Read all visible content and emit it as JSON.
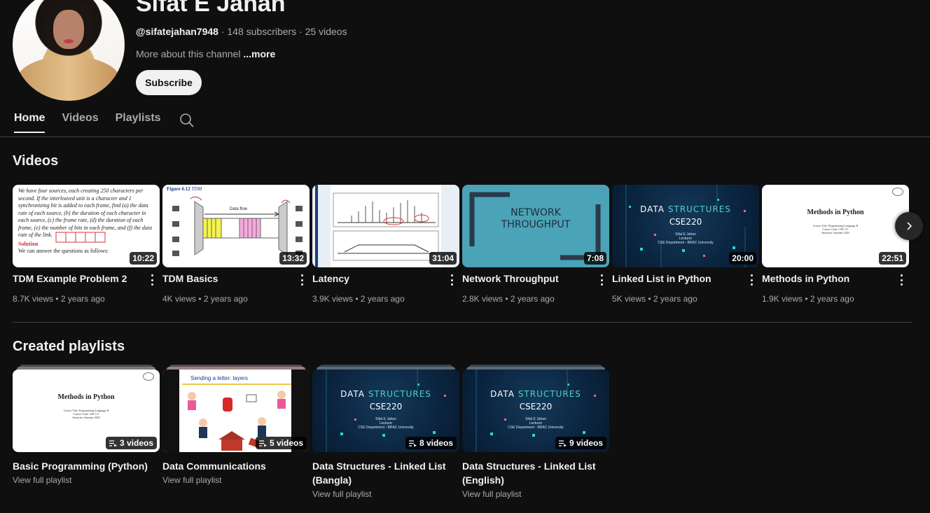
{
  "channel": {
    "name": "Sifat E Jahan",
    "handle": "@sifatejahan7948",
    "stats": " · 148 subscribers · 25 videos",
    "about": "More about this channel ",
    "about_more": "...more",
    "subscribe_label": "Subscribe"
  },
  "tabs": [
    {
      "label": "Home",
      "active": true
    },
    {
      "label": "Videos",
      "active": false
    },
    {
      "label": "Playlists",
      "active": false
    }
  ],
  "videos_section": {
    "title": "Videos",
    "items": [
      {
        "title": "TDM Example Problem 2",
        "duration": "10:22",
        "views": "8.7K views",
        "age": "2 years ago"
      },
      {
        "title": "TDM Basics",
        "duration": "13:32",
        "views": "4K views",
        "age": "2 years ago"
      },
      {
        "title": "Latency",
        "duration": "31:04",
        "views": "3.9K views",
        "age": "2 years ago"
      },
      {
        "title": "Network Throughput",
        "duration": "7:08",
        "views": "2.8K views",
        "age": "2 years ago"
      },
      {
        "title": "Linked List in Python",
        "duration": "20:00",
        "views": "5K views",
        "age": "2 years ago"
      },
      {
        "title": "Methods in Python",
        "duration": "22:51",
        "views": "1.9K views",
        "age": "2 years ago"
      }
    ]
  },
  "playlists_section": {
    "title": "Created playlists",
    "items": [
      {
        "title": "Basic Programming (Python)",
        "count": "3 videos",
        "link": "View full playlist"
      },
      {
        "title": "Data Communications",
        "count": "5 videos",
        "link": "View full playlist"
      },
      {
        "title": "Data Structures - Linked List (Bangla)",
        "count": "8 videos",
        "link": "View full playlist"
      },
      {
        "title": "Data Structures - Linked List (English)",
        "count": "9 videos",
        "link": "View full playlist"
      }
    ]
  },
  "thumb_text": {
    "tdm_problem": "We have four sources, each creating 250 characters per second. If the interleaved unit is a character and 1 synchronizing bit is added to each frame, find (a) the data rate of each source, (b) the duration of each character in each source, (c) the frame rate, (d) the duration of each frame, (e) the number of bits in each frame, and (f) the data rate of the link.",
    "tdm_solution": "Solution",
    "tdm_answer": "We can answer the questions as follows:",
    "tdm_fig": "Figure 6.12",
    "tdm_fig_sub": "TDM",
    "tdm_flow": "Data flow",
    "tdm_mux": "MUX",
    "tdm_demux": "DEMUX",
    "net_line1": "NETWORK",
    "net_line2": "THROUGHPUT",
    "ds_word1": "DATA ",
    "ds_word2": "STRUCTURES",
    "ds_course": "CSE220",
    "ds_people": "Sifat E Jahan",
    "ds_role": "Lecturer",
    "ds_dept": "CSE Department  -  BRAC University",
    "mp_title": "Methods in Python",
    "mp_course": "Course Title: Programming Language II",
    "mp_code": "Course Code: CSE 111",
    "mp_sem": "Semester: Summer 2020",
    "letter_title": "Sending a letter: layers"
  },
  "colors": {
    "background": "#0f0f0f",
    "text": "#f1f1f1",
    "muted": "#aaaaaa",
    "subscribe_bg": "#f1f1f1",
    "ds_accent": "#4fd1c5",
    "net_bg": "#4aa3b6"
  }
}
